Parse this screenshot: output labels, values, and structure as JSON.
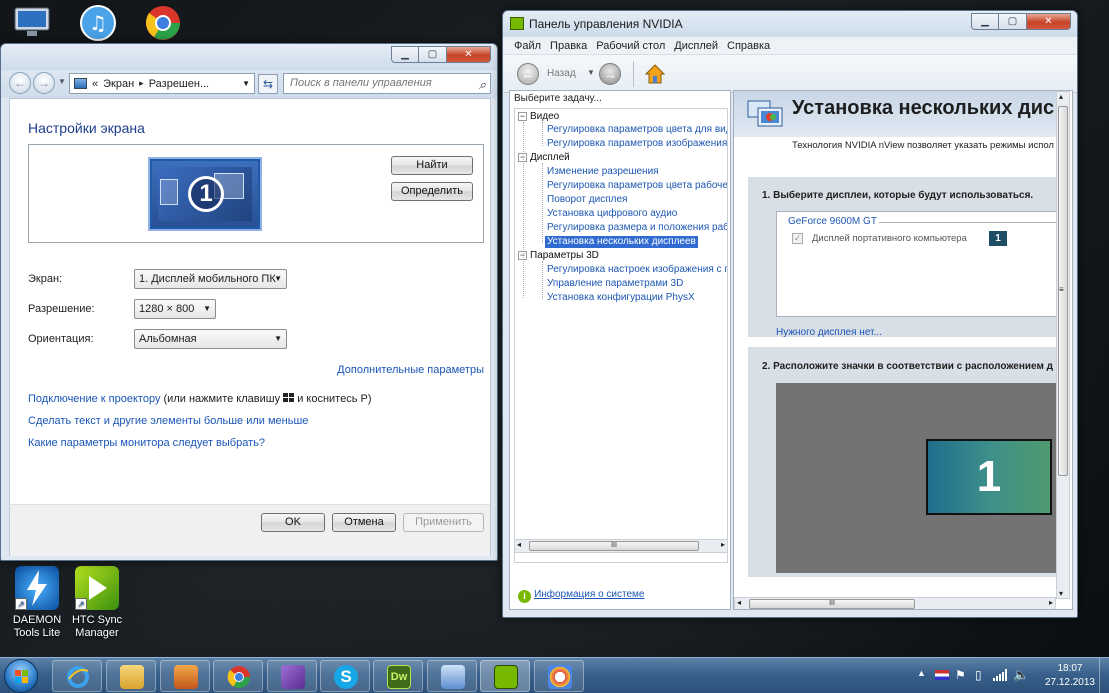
{
  "desktop": {
    "icons": [
      {
        "label": "DAEMON Tools Lite",
        "line1": "DAEMON",
        "line2": "Tools Lite"
      },
      {
        "label": "HTC Sync Manager",
        "line1": "HTC Sync",
        "line2": "Manager"
      }
    ]
  },
  "display_window": {
    "breadcrumb_sep": "«",
    "crumb1": "Экран",
    "crumb_arrow": "▸",
    "crumb2": "Разрешен...",
    "search_placeholder": "Поиск в панели управления",
    "heading": "Настройки экрана",
    "monitor_number": "1",
    "detect_label": "Найти",
    "identify_label": "Определить",
    "screen_label": "Экран:",
    "screen_value": "1. Дисплей мобильного ПК",
    "resolution_label": "Разрешение:",
    "resolution_value": "1280 × 800",
    "orientation_label": "Ориентация:",
    "orientation_value": "Альбомная",
    "advanced_link": "Дополнительные параметры",
    "projector_link": "Подключение к проектору",
    "projector_hint": "(или нажмите клавишу",
    "projector_hint2": "и коснитесь P)",
    "bigger_text_link": "Сделать текст и другие элементы больше или меньше",
    "which_monitor_link": "Какие параметры монитора следует выбрать?",
    "ok_label": "OK",
    "cancel_label": "Отмена",
    "apply_label": "Применить"
  },
  "nvidia_window": {
    "title": "Панель управления NVIDIA",
    "menu": [
      "Файл",
      "Правка",
      "Рабочий стол",
      "Дисплей",
      "Справка"
    ],
    "back_label": "Назад",
    "task_header": "Выберите задачу...",
    "tree": [
      {
        "type": "cat",
        "label": "Видео"
      },
      {
        "type": "item",
        "label": "Регулировка параметров цвета для вид"
      },
      {
        "type": "item",
        "label": "Регулировка параметров изображения д"
      },
      {
        "type": "cat",
        "label": "Дисплей"
      },
      {
        "type": "item",
        "label": "Изменение разрешения"
      },
      {
        "type": "item",
        "label": "Регулировка параметров цвета рабочег"
      },
      {
        "type": "item",
        "label": "Поворот дисплея"
      },
      {
        "type": "item",
        "label": "Установка цифрового аудио"
      },
      {
        "type": "item",
        "label": "Регулировка размера и положения рабо"
      },
      {
        "type": "item",
        "label": "Установка нескольких дисплеев",
        "selected": true
      },
      {
        "type": "cat",
        "label": "Параметры 3D"
      },
      {
        "type": "item",
        "label": "Регулировка настроек изображения с пр"
      },
      {
        "type": "item",
        "label": "Управление параметрами 3D"
      },
      {
        "type": "item",
        "label": "Установка конфигурации PhysX"
      }
    ],
    "scroll_grip": "III",
    "system_info_link": "Информация о системе",
    "page_title": "Установка нескольких дис",
    "page_desc": "Технология NVIDIA nView позволяет указать режимы испол",
    "step1_title": "1. Выберите дисплеи, которые будут использоваться.",
    "gpu_name": "GeForce 9600M GT",
    "display_item": "Дисплей портативного компьютера",
    "display_badge": "1",
    "missing_link": "Нужного дисплея нет...",
    "step2_title": "2. Расположите значки в соответствии с расположением д",
    "arrange_number": "1",
    "scrollbar_grip": "≡"
  },
  "taskbar": {
    "time": "18:07",
    "date": "27.12.2013",
    "pinned": [
      "internet-explorer",
      "explorer",
      "media-player",
      "chrome",
      "visual-studio",
      "skype",
      "dreamweaver",
      "control-panel",
      "nvidia",
      "paint"
    ]
  },
  "colors": {
    "nvidia_green": "#76b900",
    "link_blue": "#1a56b8",
    "selection_blue": "#2f6bd1",
    "taskbar_blue": "#39618c"
  }
}
